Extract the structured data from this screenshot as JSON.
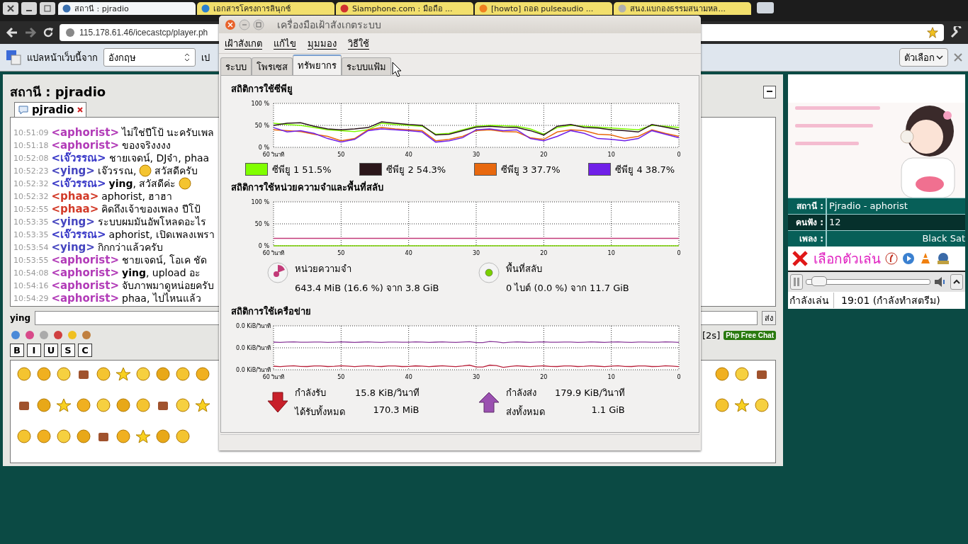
{
  "browser": {
    "tabs": [
      {
        "title": "สถานี : pjradio",
        "selected": true
      },
      {
        "title": "เอกสารโครงการลินุกซ์",
        "selected": false
      },
      {
        "title": "Siamphone.com : มือถือ ...",
        "selected": false
      },
      {
        "title": "[howto] ถอด pulseaudio ...",
        "selected": false
      },
      {
        "title": "สนง.แบกองธรรมสนามหล...",
        "selected": false
      }
    ],
    "address": "115.178.61.46/icecastcp/player.ph",
    "translate_bar": {
      "label": "แปลหน้าเว็บนี้จาก",
      "language": "อังกฤษ",
      "translate_button": "เป",
      "options": "ตัวเลือก"
    }
  },
  "chat": {
    "station_title": "สถานี : pjradio",
    "room_tab": "pjradio",
    "messages": [
      {
        "time": "10:51:09",
        "nick": "<aphorist>",
        "color": "#b23cb8",
        "parts": [
          {
            "kind": "text",
            "text": "ไม่ใช่ปีโป้ นะครับเพล"
          }
        ]
      },
      {
        "time": "10:51:18",
        "nick": "<aphorist>",
        "color": "#b23cb8",
        "parts": [
          {
            "kind": "text",
            "text": "ของจริงงงง"
          }
        ]
      },
      {
        "time": "10:52:08",
        "nick": "<เจ๊วรรณ>",
        "color": "#3a3ac8",
        "parts": [
          {
            "kind": "text",
            "text": "ชายเจดน์, DJจ๋า, phaa"
          }
        ]
      },
      {
        "time": "10:52:23",
        "nick": "<ying>",
        "color": "#4646c0",
        "parts": [
          {
            "kind": "text",
            "text": "เจ๊วรรณ,"
          },
          {
            "kind": "smiley"
          },
          {
            "kind": "text",
            "text": "สวัสดีครับ"
          }
        ]
      },
      {
        "time": "10:52:32",
        "nick": "<เจ๊วรรณ>",
        "color": "#3a3ac8",
        "parts": [
          {
            "kind": "text",
            "text": "**ying**, สวัสดีค่ะ"
          },
          {
            "kind": "smiley"
          }
        ]
      },
      {
        "time": "10:52:32",
        "nick": "<phaa>",
        "color": "#d23a28",
        "parts": [
          {
            "kind": "text",
            "text": "aphorist, ฮาฮา"
          }
        ]
      },
      {
        "time": "10:52:55",
        "nick": "<phaa>",
        "color": "#d23a28",
        "parts": [
          {
            "kind": "text",
            "text": "คิดถึงเจ้าของเพลง ปีโป้"
          }
        ]
      },
      {
        "time": "10:53:35",
        "nick": "<ying>",
        "color": "#4646c0",
        "parts": [
          {
            "kind": "text",
            "text": "ระบบผมมันอัพโหลดอะไร"
          }
        ]
      },
      {
        "time": "10:53:35",
        "nick": "<เจ๊วรรณ>",
        "color": "#3a3ac8",
        "parts": [
          {
            "kind": "text",
            "text": "aphorist, เปิดเพลงเพรา"
          }
        ]
      },
      {
        "time": "10:53:54",
        "nick": "<ying>",
        "color": "#4646c0",
        "parts": [
          {
            "kind": "text",
            "text": "กิกกว่าแล้วครับ"
          }
        ]
      },
      {
        "time": "10:53:55",
        "nick": "<aphorist>",
        "color": "#b23cb8",
        "parts": [
          {
            "kind": "text",
            "text": "ชายเจดน์, โอเค ชัด"
          }
        ]
      },
      {
        "time": "10:54:08",
        "nick": "<aphorist>",
        "color": "#b23cb8",
        "parts": [
          {
            "kind": "text",
            "text": "**ying**, upload อะ"
          }
        ]
      },
      {
        "time": "10:54:16",
        "nick": "<aphorist>",
        "color": "#b23cb8",
        "parts": [
          {
            "kind": "text",
            "text": "จับภาพมาดูหน่อยครับ"
          }
        ]
      },
      {
        "time": "10:54:29",
        "nick": "<aphorist>",
        "color": "#b23cb8",
        "parts": [
          {
            "kind": "text",
            "text": "phaa, ไปไหนแล้ว"
          }
        ]
      }
    ],
    "input_label": "ying",
    "send": "ส่ง",
    "timer": "[2s]",
    "badge": "Php Free Chat",
    "format_buttons": [
      "B",
      "I",
      "U",
      "S",
      "C"
    ]
  },
  "radio": {
    "info": [
      {
        "label": "สถานี :",
        "value": "Pjradio - aphorist"
      },
      {
        "label": "คนฟัง :",
        "value": "12"
      },
      {
        "label": "เพลง :",
        "value": "Black Sat"
      }
    ],
    "player_select": "เลือกตัวเล่น",
    "volume": {
      "level": 0.05
    },
    "status": "กำลังเล่น",
    "time": "19:01 (กำลังทำสตรีม)"
  },
  "monitor": {
    "title": "เครื่องมือเฝ้าสังเกตระบบ",
    "menu": [
      "เฝ้าสังเกต",
      "แก้ไข",
      "มุมมอง",
      "วิธีใช้"
    ],
    "tabs": [
      {
        "label": "ระบบ",
        "selected": false
      },
      {
        "label": "โพรเซส",
        "selected": false
      },
      {
        "label": "ทรัพยากร",
        "selected": true
      },
      {
        "label": "ระบบแฟ้ม",
        "selected": false
      }
    ],
    "cpu": {
      "heading": "สถิติการใช้ซีพียู",
      "chart_data": {
        "type": "line",
        "grid": true,
        "x": [
          60,
          58,
          56,
          54,
          52,
          50,
          48,
          46,
          44,
          42,
          40,
          38,
          36,
          34,
          32,
          30,
          28,
          26,
          24,
          22,
          20,
          18,
          16,
          14,
          12,
          10,
          8,
          6,
          4,
          2,
          0
        ],
        "xlim": [
          60,
          0
        ],
        "ylim": [
          0,
          100
        ],
        "xticks": [
          {
            "value": 60,
            "label": "60 วินาที"
          },
          {
            "value": 50,
            "label": "50"
          },
          {
            "value": 40,
            "label": "40"
          },
          {
            "value": 30,
            "label": "30"
          },
          {
            "value": 20,
            "label": "20"
          },
          {
            "value": 10,
            "label": "10"
          },
          {
            "value": 0,
            "label": "0"
          }
        ],
        "yticks": [
          {
            "value": 0,
            "label": "0 %"
          },
          {
            "value": 50,
            "label": "50 %"
          },
          {
            "value": 100,
            "label": "100 %"
          }
        ],
        "series": [
          {
            "name": "ซีพียู 1",
            "color": "#80ff00",
            "values": [
              55,
              52,
              50,
              45,
              40,
              38,
              36,
              40,
              55,
              52,
              50,
              48,
              30,
              32,
              40,
              48,
              50,
              49,
              48,
              42,
              30,
              45,
              50,
              48,
              46,
              44,
              42,
              40,
              50,
              48,
              45
            ]
          },
          {
            "name": "ซีพียู 2",
            "color": "#2b161a",
            "values": [
              50,
              55,
              56,
              48,
              42,
              40,
              42,
              45,
              58,
              55,
              52,
              50,
              28,
              30,
              38,
              46,
              48,
              46,
              45,
              38,
              28,
              48,
              52,
              45,
              44,
              40,
              38,
              35,
              52,
              46,
              40
            ]
          },
          {
            "name": "ซีพียู 3",
            "color": "#e8680e",
            "values": [
              40,
              38,
              36,
              30,
              25,
              15,
              20,
              40,
              45,
              42,
              40,
              38,
              15,
              18,
              25,
              38,
              40,
              36,
              35,
              22,
              18,
              35,
              40,
              38,
              30,
              28,
              20,
              25,
              40,
              32,
              25
            ]
          },
          {
            "name": "ซีพียู 4",
            "color": "#7020e8",
            "values": [
              45,
              35,
              38,
              32,
              20,
              12,
              18,
              38,
              42,
              40,
              38,
              35,
              12,
              15,
              22,
              40,
              42,
              38,
              40,
              20,
              15,
              25,
              38,
              32,
              20,
              18,
              15,
              20,
              38,
              30,
              22
            ]
          }
        ]
      },
      "legend": [
        "51.5%",
        "54.3%",
        "37.7%",
        "38.7%"
      ]
    },
    "memory": {
      "heading": "สถิติการใช้หน่วยความจำและพื้นที่สลับ",
      "chart_data": {
        "type": "line",
        "grid": true,
        "x": [
          60,
          0
        ],
        "xlim": [
          60,
          0
        ],
        "ylim": [
          0,
          100
        ],
        "xticks": [
          {
            "value": 60,
            "label": "60 วินาที"
          },
          {
            "value": 50,
            "label": "50"
          },
          {
            "value": 40,
            "label": "40"
          },
          {
            "value": 30,
            "label": "30"
          },
          {
            "value": 20,
            "label": "20"
          },
          {
            "value": 10,
            "label": "10"
          },
          {
            "value": 0,
            "label": "0"
          }
        ],
        "yticks": [
          {
            "value": 0,
            "label": "0 %"
          },
          {
            "value": 50,
            "label": "50 %"
          },
          {
            "value": 100,
            "label": "100 %"
          }
        ],
        "series": [
          {
            "name": "หน่วยความจำ",
            "color": "#c23a78",
            "values": [
              17,
              17
            ]
          },
          {
            "name": "พื้นที่สลับ",
            "color": "#7ad000",
            "values": [
              0,
              0
            ]
          }
        ]
      },
      "details": [
        "643.4 MiB (16.6 %) จาก 3.8 GiB",
        "0 ไบต์ (0.0 %) จาก 11.7 GiB"
      ]
    },
    "network": {
      "heading": "สถิติการใช้เครือข่าย",
      "y_labels": [
        "0.0 KiB/วินาที",
        "0.0 KiB/วินาที",
        "0.0 KiB/วินาที"
      ],
      "x_labels": [
        "60 วินาที",
        "50",
        "40",
        "30",
        "20",
        "10",
        "0"
      ],
      "rows": [
        {
          "kind": "down",
          "rate_label": "กำลังรับ",
          "rate": "15.8 KiB/วินาที",
          "total_label": "ได้รับทั้งหมด",
          "total": "170.3 MiB"
        },
        {
          "kind": "up",
          "rate_label": "กำลังส่ง",
          "rate": "179.9 KiB/วินาที",
          "total_label": "ส่งทั้งหมด",
          "total": "1.1 GiB"
        }
      ]
    }
  }
}
